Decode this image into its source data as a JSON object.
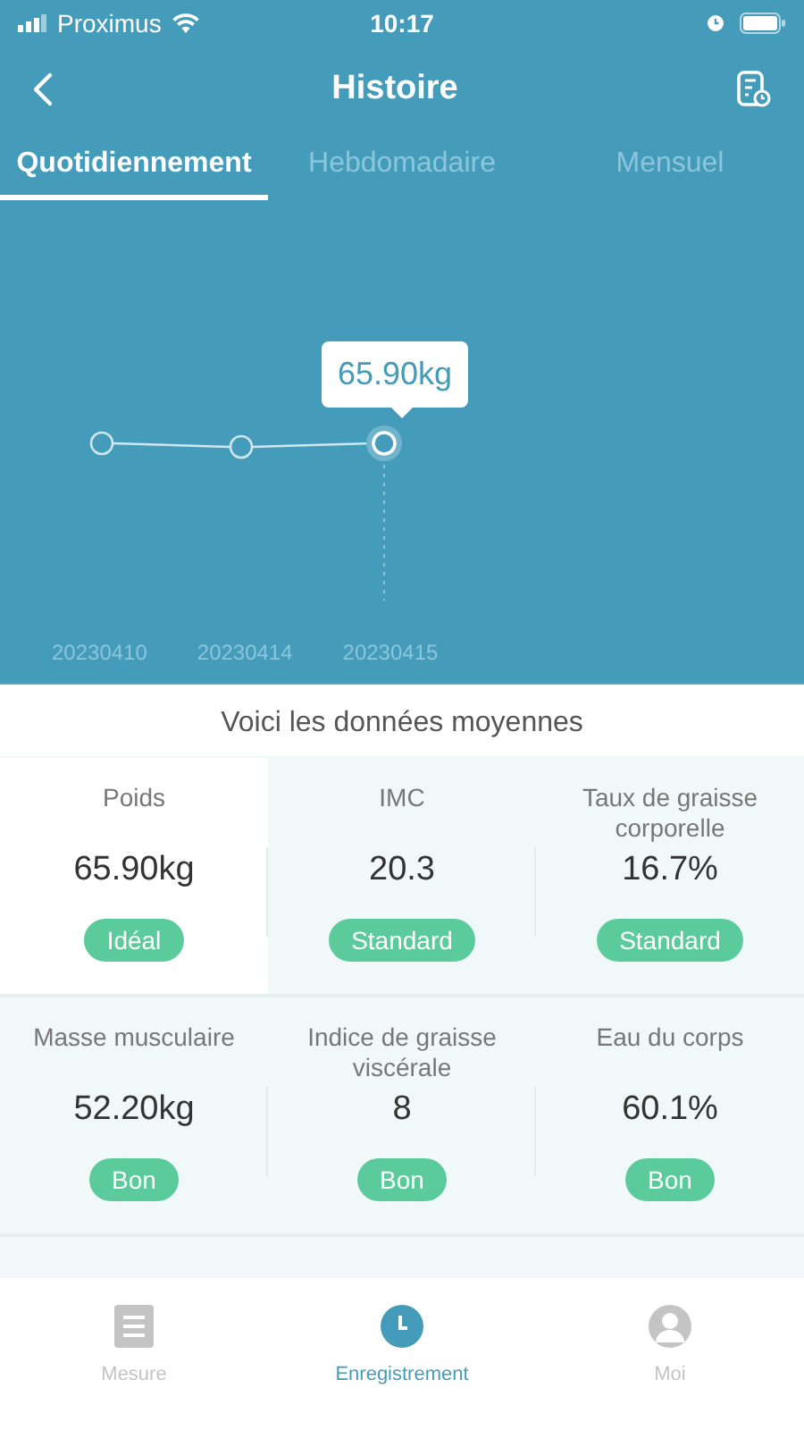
{
  "status_bar": {
    "carrier": "Proximus",
    "time": "10:17"
  },
  "header": {
    "title": "Histoire"
  },
  "tabs": [
    {
      "label": "Quotidiennement",
      "selected": true
    },
    {
      "label": "Hebdomadaire",
      "selected": false
    },
    {
      "label": "Mensuel",
      "selected": false
    }
  ],
  "chart": {
    "tooltip": "65.90kg",
    "dates": [
      "20230410",
      "20230414",
      "20230415"
    ]
  },
  "summary_title": "Voici les données moyennes",
  "metrics": [
    {
      "label": "Poids",
      "value": "65.90kg",
      "status": "Idéal",
      "highlighted": true
    },
    {
      "label": "IMC",
      "value": "20.3",
      "status": "Standard",
      "highlighted": false
    },
    {
      "label": "Taux de graisse corporelle",
      "value": "16.7%",
      "status": "Standard",
      "highlighted": false
    },
    {
      "label": "Masse musculaire",
      "value": "52.20kg",
      "status": "Bon",
      "highlighted": false
    },
    {
      "label": "Indice de graisse viscérale",
      "value": "8",
      "status": "Bon",
      "highlighted": false
    },
    {
      "label": "Eau du corps",
      "value": "60.1%",
      "status": "Bon",
      "highlighted": false
    }
  ],
  "bottom_nav": [
    {
      "label": "Mesure",
      "kind": "list",
      "selected": false
    },
    {
      "label": "Enregistrement",
      "kind": "clock",
      "selected": true
    },
    {
      "label": "Moi",
      "kind": "person",
      "selected": false
    }
  ]
}
